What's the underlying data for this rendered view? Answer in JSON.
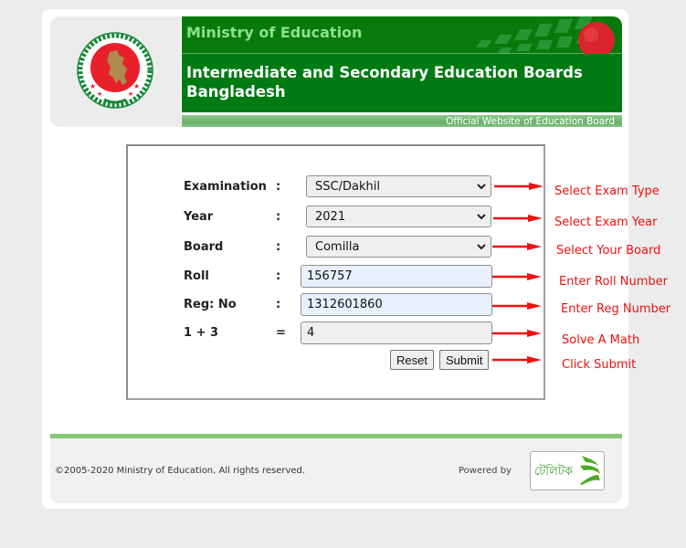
{
  "header": {
    "logo_alt": "Government of Bangladesh emblem",
    "ministry": "Ministry of Education",
    "title_line1": "Intermediate and Secondary Education Boards",
    "title_line2": "Bangladesh",
    "tagline": "Official Website of Education Board"
  },
  "form": {
    "fields": [
      {
        "label": "Examination",
        "sep": ":",
        "type": "select",
        "value": "SSC/Dakhil"
      },
      {
        "label": "Year",
        "sep": ":",
        "type": "select",
        "value": "2021"
      },
      {
        "label": "Board",
        "sep": ":",
        "type": "select",
        "value": "Comilla"
      },
      {
        "label": "Roll",
        "sep": ":",
        "type": "text",
        "value": "156757"
      },
      {
        "label": "Reg: No",
        "sep": ":",
        "type": "text",
        "value": "1312601860"
      },
      {
        "label": "1 + 3",
        "sep": "=",
        "type": "text",
        "value": "4"
      }
    ],
    "reset_label": "Reset",
    "submit_label": "Submit"
  },
  "annotations": {
    "color": "#ee1111",
    "items": [
      "Select Exam Type",
      "Select Exam Year",
      "Select Your Board",
      "Enter Roll Number",
      "Enter Reg Number",
      "Solve A Math",
      "Click Submit"
    ]
  },
  "footer": {
    "copyright": "©2005-2020 Ministry of Education, All rights reserved.",
    "powered_by": "Powered by",
    "partner_logo_text": "টেলিটক"
  },
  "colors": {
    "brand_green": "#007a13",
    "ministry_text": "#8ee08e",
    "footer_bar": "#86c676"
  }
}
